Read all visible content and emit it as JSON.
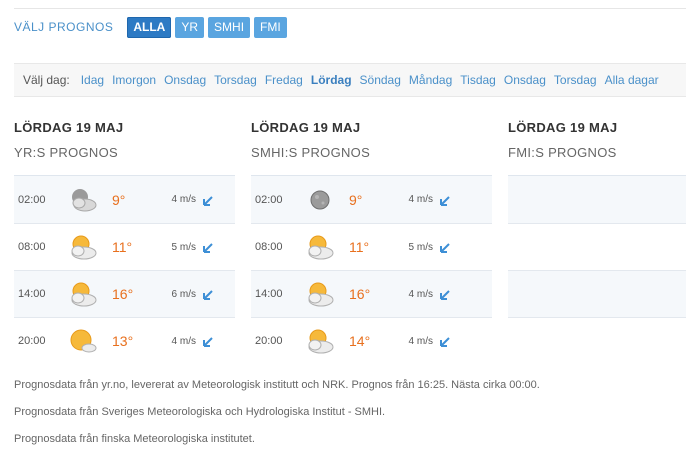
{
  "prognos": {
    "label": "VÄLJ PROGNOS",
    "buttons": [
      {
        "label": "ALLA",
        "active": true
      },
      {
        "label": "YR",
        "active": false
      },
      {
        "label": "SMHI",
        "active": false
      },
      {
        "label": "FMI",
        "active": false
      }
    ]
  },
  "days": {
    "label": "Välj dag:",
    "items": [
      "Idag",
      "Imorgon",
      "Onsdag",
      "Torsdag",
      "Fredag",
      "Lördag",
      "Söndag",
      "Måndag",
      "Tisdag",
      "Onsdag",
      "Torsdag",
      "Alla dagar"
    ],
    "active_index": 5
  },
  "columns": [
    {
      "title": "LÖRDAG 19 MAJ",
      "subtitle": "YR:S PROGNOS",
      "rows": [
        {
          "time": "02:00",
          "icon": "partly-cloudy-night-icon",
          "temp": "9°",
          "wind": "4 m/s"
        },
        {
          "time": "08:00",
          "icon": "sun-behind-cloud-icon",
          "temp": "11°",
          "wind": "5 m/s"
        },
        {
          "time": "14:00",
          "icon": "sun-behind-cloud-icon",
          "temp": "16°",
          "wind": "6 m/s"
        },
        {
          "time": "20:00",
          "icon": "sun-small-cloud-icon",
          "temp": "13°",
          "wind": "4 m/s"
        }
      ]
    },
    {
      "title": "LÖRDAG 19 MAJ",
      "subtitle": "SMHI:S PROGNOS",
      "rows": [
        {
          "time": "02:00",
          "icon": "moon-icon",
          "temp": "9°",
          "wind": "4 m/s"
        },
        {
          "time": "08:00",
          "icon": "sun-behind-cloud-icon",
          "temp": "11°",
          "wind": "5 m/s"
        },
        {
          "time": "14:00",
          "icon": "sun-behind-cloud-icon",
          "temp": "16°",
          "wind": "4 m/s"
        },
        {
          "time": "20:00",
          "icon": "sun-behind-cloud-icon",
          "temp": "14°",
          "wind": "4 m/s"
        }
      ]
    },
    {
      "title": "LÖRDAG 19 MAJ",
      "subtitle": "FMI:S PROGNOS",
      "rows": []
    }
  ],
  "notes": [
    "Prognosdata från yr.no, levererat av Meteorologisk institutt och NRK. Prognos från 16:25. Nästa cirka 00:00.",
    "Prognosdata från Sveriges Meteorologiska och Hydrologiska Institut - SMHI.",
    "Prognosdata från finska Meteorologiska institutet."
  ],
  "colors": {
    "accent": "#4a90c9",
    "button": "#5aa5e0",
    "button_active": "#2d7ac4",
    "temp": "#e8701e",
    "wind_arrow": "#3d8fd6"
  }
}
